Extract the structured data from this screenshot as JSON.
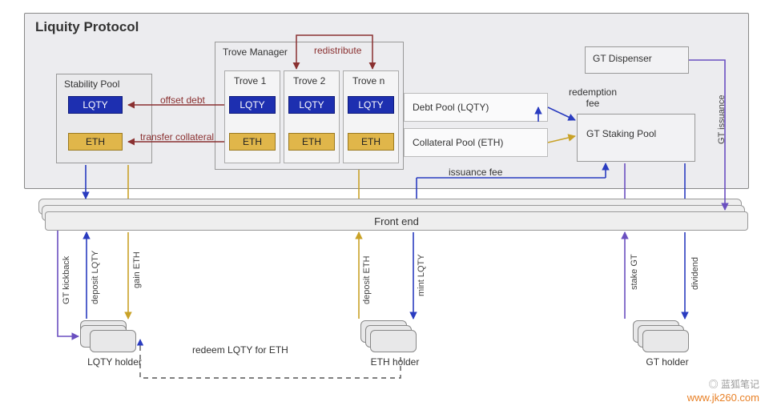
{
  "protocol_title": "Liquity Protocol",
  "trove_manager": "Trove Manager",
  "stability_pool": "Stability Pool",
  "gt_dispenser": "GT Dispenser",
  "gt_staking_pool": "GT Staking Pool",
  "troves": [
    "Trove 1",
    "Trove 2",
    "Trove n"
  ],
  "debt_pool": "Debt Pool (LQTY)",
  "collateral_pool": "Collateral Pool (ETH)",
  "frontend": "Front end",
  "chips": {
    "lqty": "LQTY",
    "eth": "ETH"
  },
  "holders": {
    "lqty": "LQTY holder",
    "eth": "ETH holder",
    "gt": "GT holder"
  },
  "edges": {
    "redistribute": "redistribute",
    "offset_debt": "offset debt",
    "transfer_collateral": "transfer collateral",
    "issuance_fee": "issuance fee",
    "redemption_fee": "redemption fee",
    "gt_issuance": "GT issuance",
    "gt_kickback": "GT kickback",
    "deposit_lqty": "deposit LQTY",
    "gain_eth": "gain ETH",
    "deposit_eth": "deposit ETH",
    "mint_lqty": "mint LQTY",
    "stake_gt": "stake GT",
    "dividend": "dividend",
    "redeem": "redeem LQTY for ETH"
  },
  "watermark": "www.jk260.com",
  "watermark_cn": "蓝狐笔记",
  "colors": {
    "blue": "#1d2fb0",
    "amber": "#e0b64a",
    "purple": "#6a4fc0",
    "red": "#8a3030",
    "gold": "#c9a227",
    "dblue": "#2a3cc0"
  }
}
